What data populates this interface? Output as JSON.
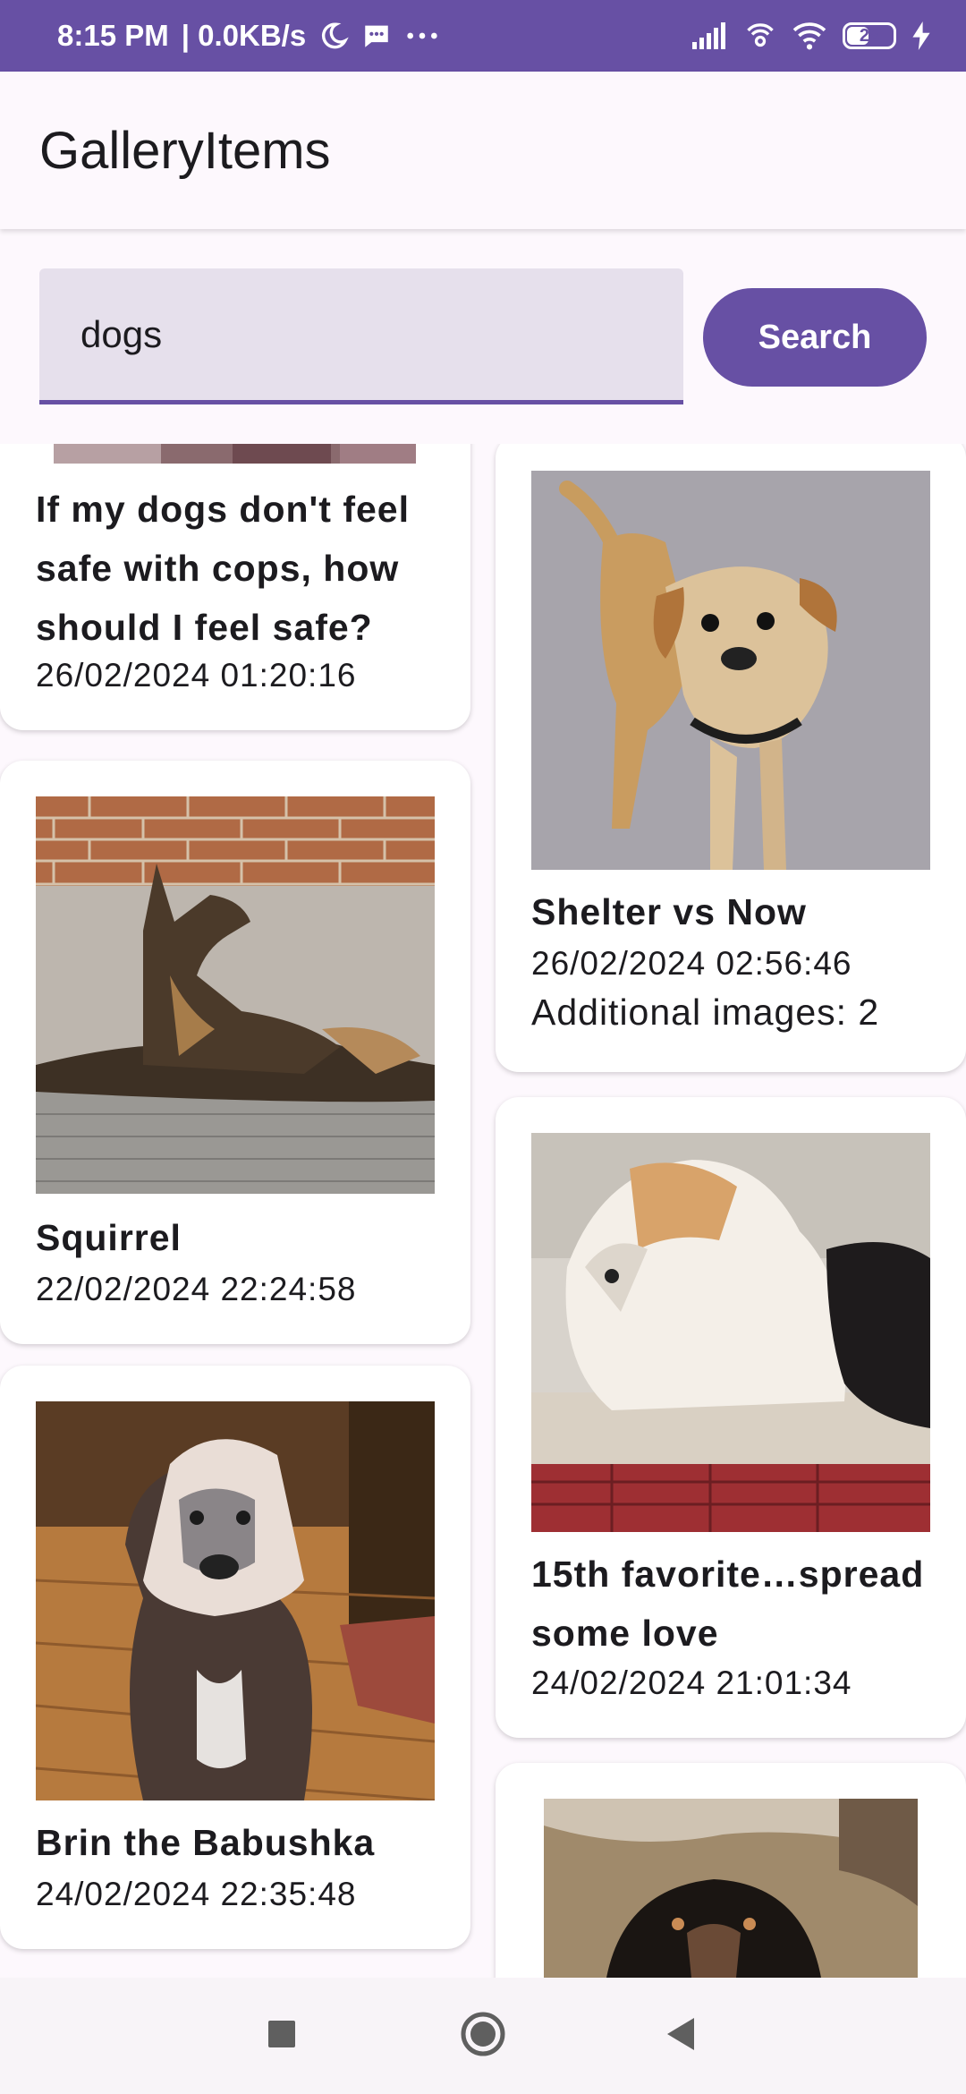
{
  "status_bar": {
    "time": "8:15 PM",
    "net_speed": "| 0.0KB/s",
    "battery": "28",
    "icons": [
      "moon-icon",
      "message-icon",
      "more-icon",
      "signal-icon",
      "hotspot-icon",
      "wifi-icon",
      "battery-icon",
      "charging-icon"
    ]
  },
  "app_bar": {
    "title": "GalleryItems"
  },
  "search": {
    "value": "dogs",
    "button_label": "Search"
  },
  "gallery": {
    "left": [
      {
        "title": "If my dogs don't feel safe with cops, how should I feel safe?",
        "date": "26/02/2024 01:20:16"
      },
      {
        "title": "Squirrel",
        "date": "22/02/2024 22:24:58"
      },
      {
        "title": "Brin the Babushka",
        "date": "24/02/2024 22:35:48"
      }
    ],
    "right": [
      {
        "title": "Shelter vs Now",
        "date": "26/02/2024 02:56:46",
        "extra": "Additional images: 2"
      },
      {
        "title": "15th favorite…spread some love",
        "date": "24/02/2024 21:01:34"
      },
      {
        "title": "",
        "date": ""
      }
    ]
  },
  "nav_bar": {
    "icons": [
      "recents-icon",
      "home-icon",
      "back-icon"
    ]
  },
  "colors": {
    "primary": "#6750a4",
    "field": "#e6e0ec",
    "background": "#fdf8fd"
  }
}
